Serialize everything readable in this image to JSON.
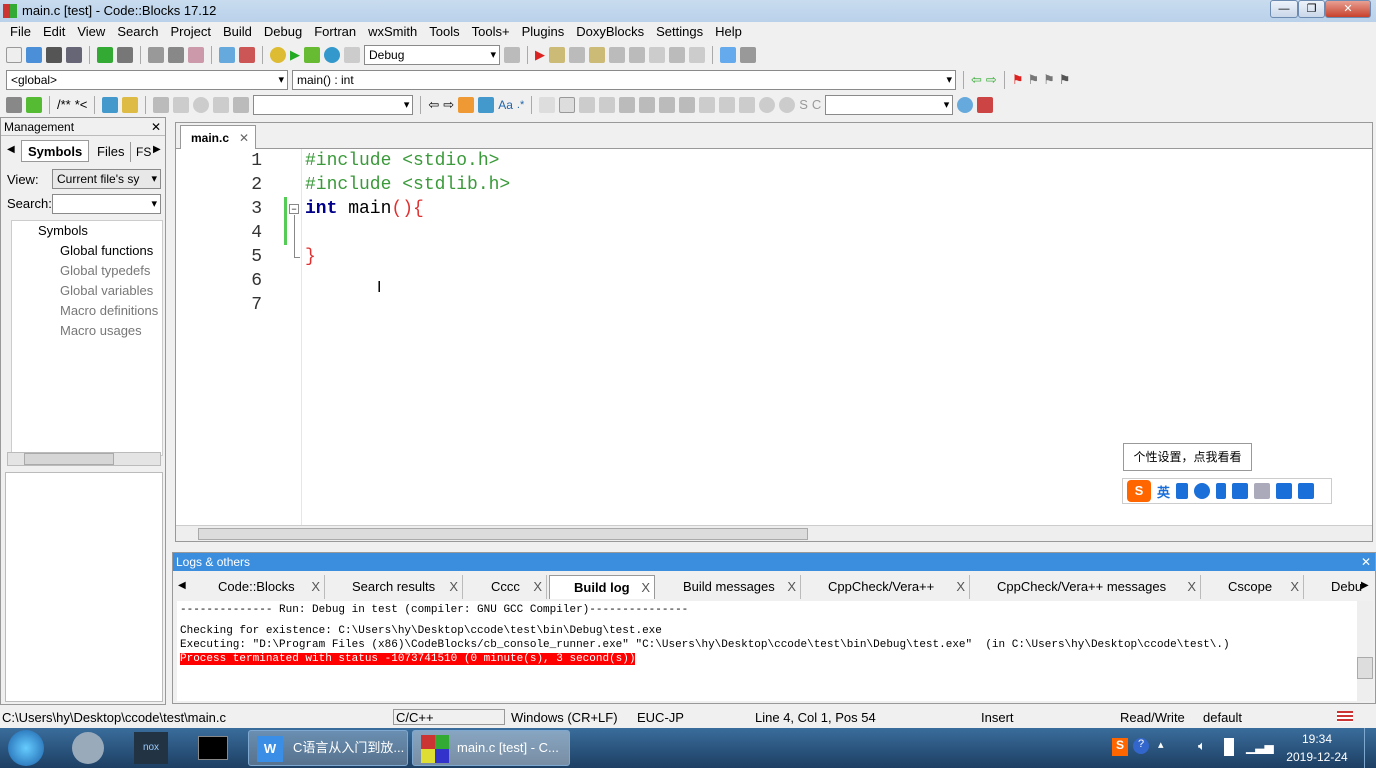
{
  "window": {
    "title": "main.c [test] - Code::Blocks 17.12",
    "min": "—",
    "max": "❐",
    "close": "✕"
  },
  "menu": [
    "File",
    "Edit",
    "View",
    "Search",
    "Project",
    "Build",
    "Debug",
    "Fortran",
    "wxSmith",
    "Tools",
    "Tools+",
    "Plugins",
    "DoxyBlocks",
    "Settings",
    "Help"
  ],
  "toolbar": {
    "build_target": "Debug",
    "scope": "<global>",
    "function": "main() : int",
    "doxy1": "/**",
    "doxy2": "*<"
  },
  "management": {
    "title": "Management",
    "close": "✕",
    "tabs": [
      "Symbols",
      "Files",
      "FS"
    ],
    "view_label": "View:",
    "view_value": "Current file's sy",
    "search_label": "Search:",
    "tree": [
      "Symbols",
      "Global functions",
      "Global typedefs",
      "Global variables",
      "Macro definitions",
      "Macro usages"
    ]
  },
  "editor": {
    "tab": "main.c",
    "tab_close": "✕",
    "lines": [
      {
        "n": "1",
        "text": "#include <stdio.h>",
        "color": "#3a9a3a"
      },
      {
        "n": "2",
        "text": "#include <stdlib.h>",
        "color": "#3a9a3a"
      },
      {
        "n": "3",
        "text": "int main(){"
      },
      {
        "n": "4",
        "text": ""
      },
      {
        "n": "5",
        "text": "}"
      },
      {
        "n": "6",
        "text": ""
      },
      {
        "n": "7",
        "text": ""
      }
    ]
  },
  "ime": {
    "tooltip": "个性设置，点我看看",
    "lang": "英"
  },
  "logs": {
    "title": "Logs & others",
    "close": "✕",
    "tabs": [
      "Code::Blocks",
      "Search results",
      "Cccc",
      "Build log",
      "Build messages",
      "CppCheck/Vera++",
      "CppCheck/Vera++ messages",
      "Cscope",
      "Debu"
    ],
    "active_tab": "Build log",
    "lines": [
      "-------------- Run: Debug in test (compiler: GNU GCC Compiler)---------------",
      "Checking for existence: C:\\Users\\hy\\Desktop\\ccode\\test\\bin\\Debug\\test.exe",
      "Executing: \"D:\\Program Files (x86)\\CodeBlocks/cb_console_runner.exe\" \"C:\\Users\\hy\\Desktop\\ccode\\test\\bin\\Debug\\test.exe\"  (in C:\\Users\\hy\\Desktop\\ccode\\test\\.)",
      "Process terminated with status -1073741510 (0 minute(s), 3 second(s))"
    ],
    "error_color": "#ff0000"
  },
  "status": {
    "path": "C:\\Users\\hy\\Desktop\\ccode\\test\\main.c",
    "lang": "C/C++",
    "eol": "Windows (CR+LF)",
    "encoding": "EUC-JP",
    "position": "Line 4, Col 1, Pos 54",
    "mode": "Insert",
    "access": "Read/Write",
    "theme": "default"
  },
  "taskbar": {
    "tasks": [
      "C语言从入门到放...",
      "main.c [test] - C..."
    ],
    "time": "19:34",
    "date": "2019-12-24"
  }
}
